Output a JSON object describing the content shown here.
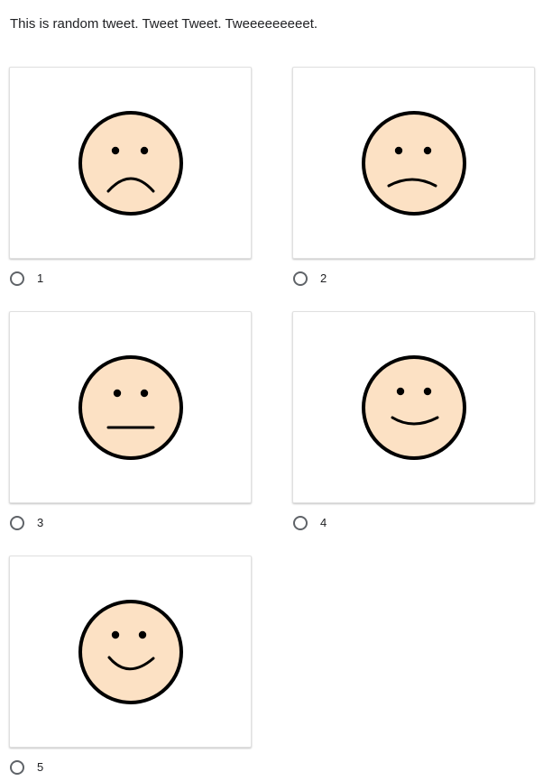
{
  "question": {
    "title": "This is random tweet. Tweet Tweet. Tweeeeeeeeet."
  },
  "options": [
    {
      "label": "1",
      "face": "very-sad-face-icon"
    },
    {
      "label": "2",
      "face": "sad-face-icon"
    },
    {
      "label": "3",
      "face": "neutral-face-icon"
    },
    {
      "label": "4",
      "face": "happy-face-icon"
    },
    {
      "label": "5",
      "face": "very-happy-face-icon"
    }
  ],
  "colors": {
    "face_fill": "#fce1c4",
    "face_stroke": "#000000",
    "radio_border": "#5f6368",
    "text": "#202124"
  }
}
